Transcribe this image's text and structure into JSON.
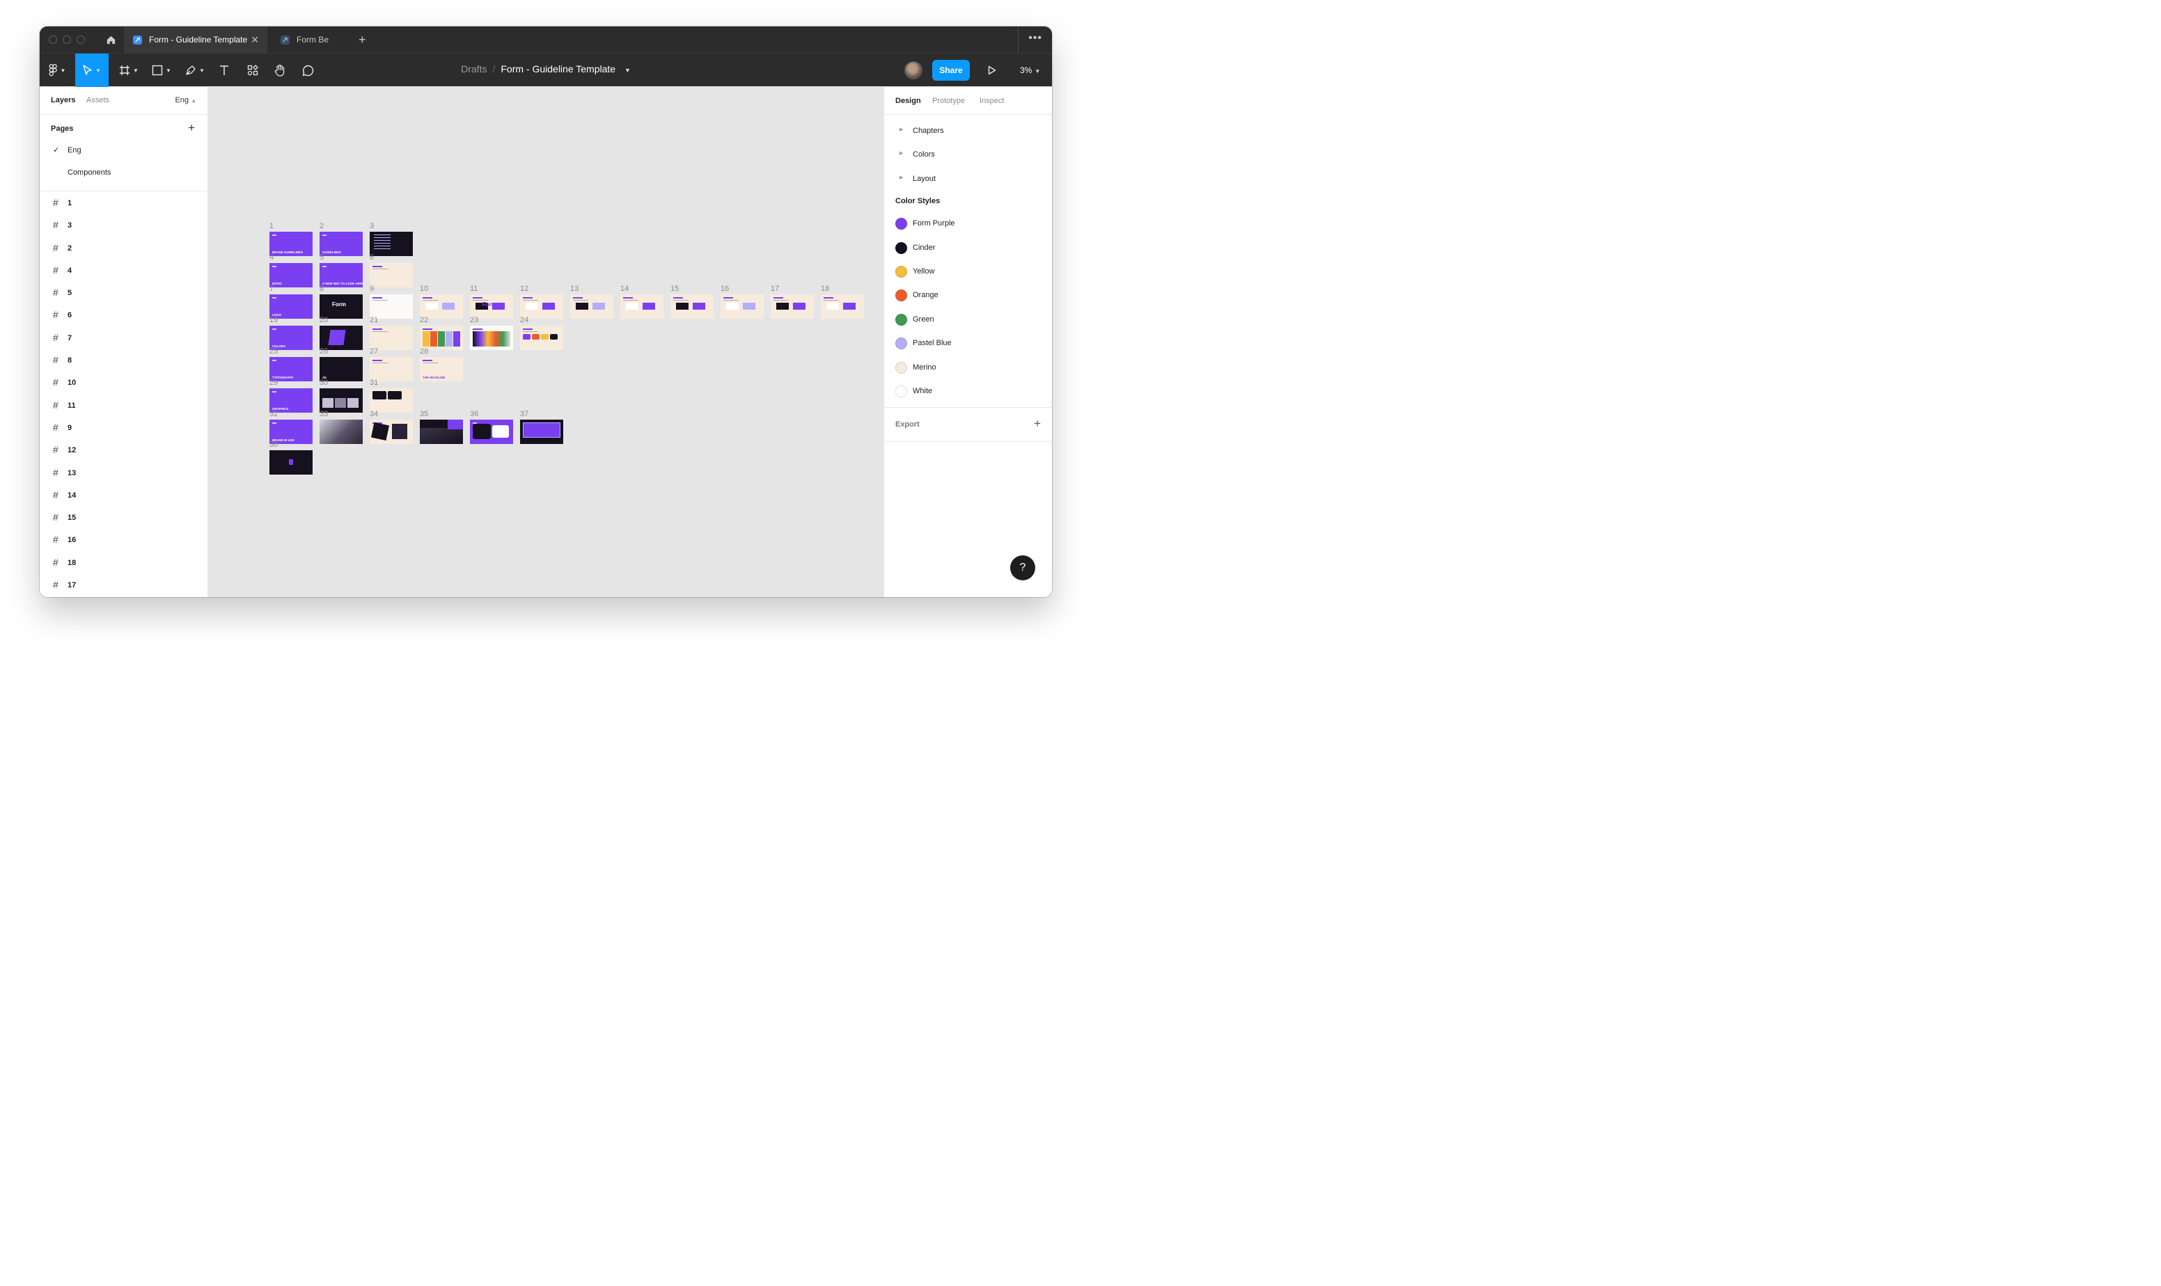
{
  "tabs": [
    {
      "label": "Form - Guideline Template",
      "active": true
    },
    {
      "label": "Form Be",
      "active": false
    }
  ],
  "breadcrumb": {
    "parent": "Drafts",
    "separator": "/",
    "file": "Form - Guideline Template"
  },
  "toolbar": {
    "share_label": "Share",
    "zoom": "3%"
  },
  "left_panel": {
    "tabs": [
      "Layers",
      "Assets"
    ],
    "current_page": "Eng",
    "pages_title": "Pages",
    "pages": [
      {
        "label": "Eng",
        "selected": true
      },
      {
        "label": "Components",
        "selected": false
      }
    ],
    "layers": [
      "1",
      "3",
      "2",
      "4",
      "5",
      "6",
      "7",
      "8",
      "10",
      "11",
      "9",
      "12",
      "13",
      "14",
      "15",
      "16",
      "18",
      "17"
    ]
  },
  "right_panel": {
    "tabs": [
      "Design",
      "Prototype",
      "Inspect"
    ],
    "groups": [
      "Chapters",
      "Colors",
      "Layout"
    ],
    "color_styles_title": "Color Styles",
    "color_styles": [
      {
        "name": "Form Purple",
        "color": "#7b3ff2"
      },
      {
        "name": "Cinder",
        "color": "#130f1f"
      },
      {
        "name": "Yellow",
        "color": "#f4bd3b"
      },
      {
        "name": "Orange",
        "color": "#ec5b2a"
      },
      {
        "name": "Green",
        "color": "#3f9a55"
      },
      {
        "name": "Pastel Blue",
        "color": "#b3aefc"
      },
      {
        "name": "Merino",
        "color": "#f7ebdd"
      },
      {
        "name": "White",
        "color": "#ffffff"
      }
    ],
    "export_label": "Export"
  },
  "canvas": {
    "frames": [
      {
        "n": "1",
        "style": "purple",
        "text": "BRAND GUIDELINES"
      },
      {
        "n": "2",
        "style": "purple",
        "text": "GUIDELINES"
      },
      {
        "n": "3",
        "style": "dark"
      },
      {
        "n": "4",
        "style": "purple",
        "text": "INTRO"
      },
      {
        "n": "5",
        "style": "purple",
        "text": "A NEW WAY TO LOOK AROUND YOU"
      },
      {
        "n": "6",
        "style": "cream"
      },
      {
        "n": "7",
        "style": "purple",
        "text": "LOGO"
      },
      {
        "n": "8",
        "style": "dark",
        "text": "Form"
      },
      {
        "n": "9",
        "style": "white"
      },
      {
        "n": "10",
        "style": "cream"
      },
      {
        "n": "11",
        "style": "cream",
        "text": "Form"
      },
      {
        "n": "12",
        "style": "cream"
      },
      {
        "n": "13",
        "style": "cream"
      },
      {
        "n": "14",
        "style": "cream"
      },
      {
        "n": "15",
        "style": "cream"
      },
      {
        "n": "16",
        "style": "cream"
      },
      {
        "n": "17",
        "style": "cream"
      },
      {
        "n": "18",
        "style": "cream"
      },
      {
        "n": "19",
        "style": "purple",
        "text": "COLORS"
      },
      {
        "n": "20",
        "style": "dark"
      },
      {
        "n": "21",
        "style": "cream"
      },
      {
        "n": "22",
        "style": "cream"
      },
      {
        "n": "23",
        "style": "white"
      },
      {
        "n": "24",
        "style": "cream"
      },
      {
        "n": "25",
        "style": "purple",
        "text": "TYPOGRAPHY"
      },
      {
        "n": "26",
        "style": "dark",
        "text": "Ab"
      },
      {
        "n": "27",
        "style": "cream"
      },
      {
        "n": "28",
        "style": "cream",
        "text": "THE HEADLINE"
      },
      {
        "n": "29",
        "style": "purple",
        "text": "GRAPHICS"
      },
      {
        "n": "30",
        "style": "dark"
      },
      {
        "n": "31",
        "style": "cream"
      },
      {
        "n": "32",
        "style": "purple",
        "text": "BRAND IN USE"
      },
      {
        "n": "33",
        "style": "photo"
      },
      {
        "n": "34",
        "style": "cream"
      },
      {
        "n": "35",
        "style": "dark"
      },
      {
        "n": "36",
        "style": "purple"
      },
      {
        "n": "37",
        "style": "dark"
      },
      {
        "n": "38",
        "style": "dark"
      }
    ]
  },
  "help_label": "?"
}
